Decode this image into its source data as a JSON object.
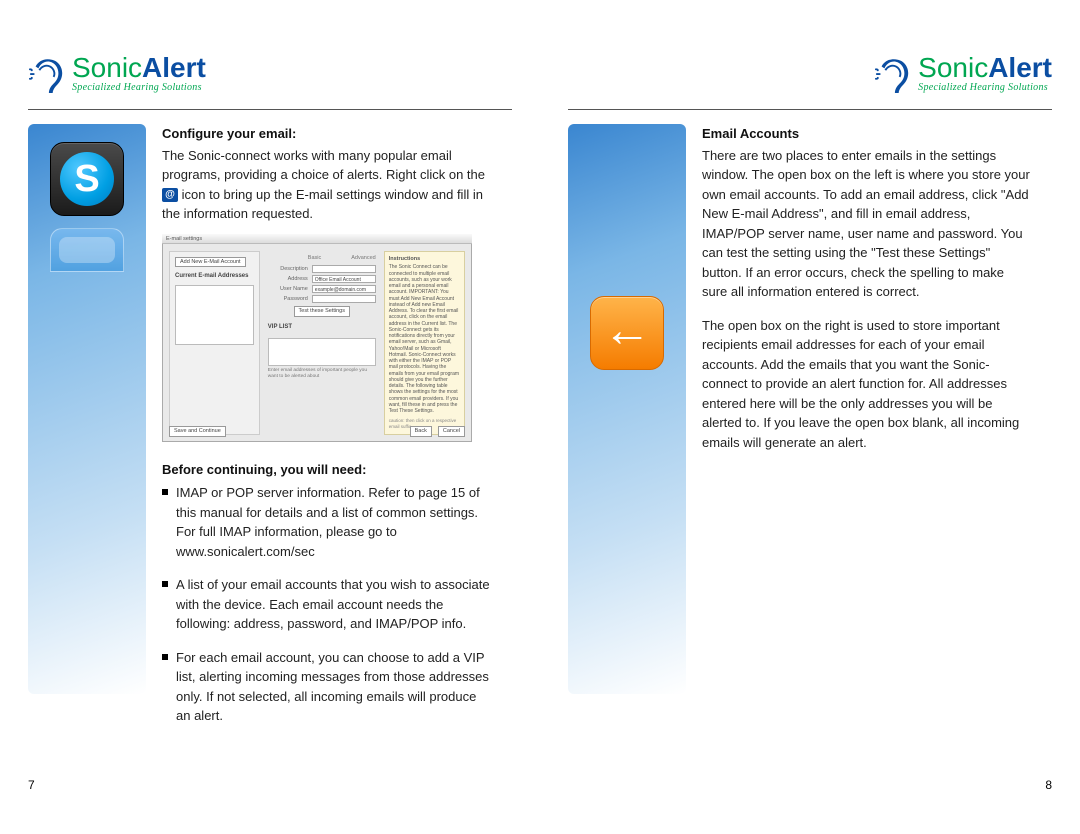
{
  "brand": {
    "word1": "Sonic",
    "word2": "Alert",
    "tagline": "Specialized Hearing Solutions"
  },
  "left": {
    "strip_icon_main": "skype-icon",
    "section1_heading": "Configure your email:",
    "section1_p1a": "The Sonic-connect works with many popular email programs, providing a choice of alerts. Right click on the ",
    "section1_p1b": " icon to bring up the E-mail settings window and fill in the information requested.",
    "settings_window": {
      "titlebar": "E-mail settings",
      "add_btn": "Add New E-Mail Account",
      "left_heading": "Current E-mail Addresses",
      "mid_labels": [
        "Description",
        "Address",
        "User Name",
        "Password"
      ],
      "mid_values": [
        "",
        "Office Email Account",
        "example@domain.com",
        ""
      ],
      "mid_test_btn": "Test these Settings",
      "vip_heading": "VIP LIST",
      "vip_hint": "Enter email addresses of important people you want to be alerted about",
      "right_heading": "Instructions",
      "right_body": "The Sonic Connect can be connected to multiple email accounts, such as your work email and a personal email account. IMPORTANT: You must Add New Email Account instead of Add new Email Address. To clear the first email account, click on the email address in the Current list. The Sonic-Connect gets its notifications directly from your email server, such as Gmail, Yahoo!Mail or Microsoft Hotmail. Sonic-Connect works with either the IMAP or POP mail protocols. Having the emails from your email program should give you the further details. The following table shows the settings for the most common email providers. If you want, fill these in and press the Test These Settings.",
      "right_footnote": "caution: then click on a respective email suffix.",
      "bottom_save": "Save and Continue",
      "bottom_back": "Back",
      "bottom_cancel": "Cancel"
    },
    "section2_heading": "Before continuing, you will need:",
    "bullets": [
      "IMAP or POP server information. Refer to page 15 of this manual for details and a list of common settings. For full IMAP information, please go to www.sonicalert.com/sec",
      "A list of your email accounts that you wish to associate with the device. Each email account needs the following: address, password, and IMAP/POP info.",
      "For each email account, you can choose to add a VIP list, alerting incoming messages from those addresses only. If not selected, all incoming emails will produce an alert."
    ],
    "pagenum": "7"
  },
  "right": {
    "strip_icon_main": "back-arrow-icon",
    "section1_heading": "Email Accounts",
    "section1_p1": "There are two places to enter emails in the settings window. The open box on the left is where you store your own  email accounts. To add an email address, click \"Add New E-mail Address\", and fill in email address, IMAP/POP server name, user name and password. You can test the setting using the \"Test these Settings\" button. If an error occurs, check the spelling to make sure all information entered is correct.",
    "section1_p2": "The open box on the right is used to store important recipients email addresses for each of your email accounts. Add the emails that you want the Sonic-connect to provide an alert function for. All addresses entered here will be the only addresses you will be alerted to. If you leave the open box blank, all incoming emails will generate an alert.",
    "pagenum": "8"
  }
}
